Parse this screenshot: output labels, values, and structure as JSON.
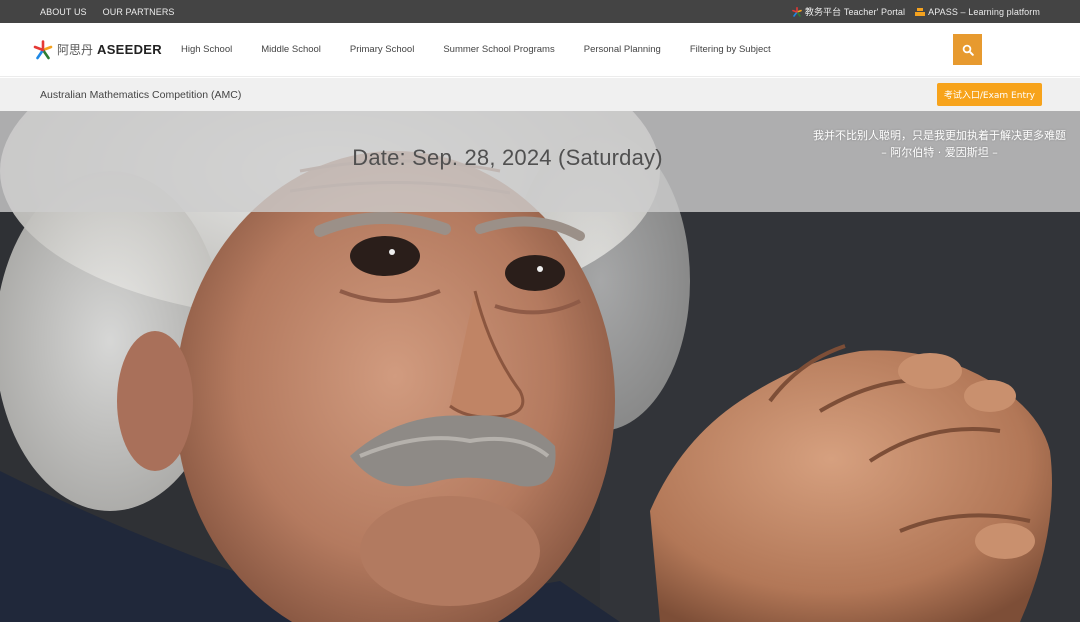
{
  "topbar": {
    "about": "ABOUT US",
    "partners": "OUR PARTNERS",
    "teacher_portal": "教务平台 Teacher' Portal",
    "apass": "APASS – Learning platform"
  },
  "brand": {
    "cn": "阿思丹",
    "en": "ASEEDER"
  },
  "nav": {
    "items": [
      {
        "label": "High School"
      },
      {
        "label": "Middle School"
      },
      {
        "label": "Primary School"
      },
      {
        "label": "Summer School Programs"
      },
      {
        "label": "Personal Planning"
      },
      {
        "label": "Filtering by Subject"
      }
    ],
    "search_icon": "search-icon"
  },
  "subheader": {
    "title": "Australian Mathematics Competition (AMC)",
    "exam_entry": "考试入口/Exam Entry"
  },
  "hero": {
    "date": "Date: Sep. 28, 2024 (Saturday)",
    "quote_line1": "我并不比别人聪明，只是我更加执着于解决更多难题",
    "quote_line2": "– 阿尔伯特 · 爱因斯坦 –"
  },
  "colors": {
    "topbar_bg": "#444444",
    "accent_orange": "#e79a2f",
    "exam_button": "#f7a31b",
    "subbar_bg": "#f0f0f0"
  }
}
